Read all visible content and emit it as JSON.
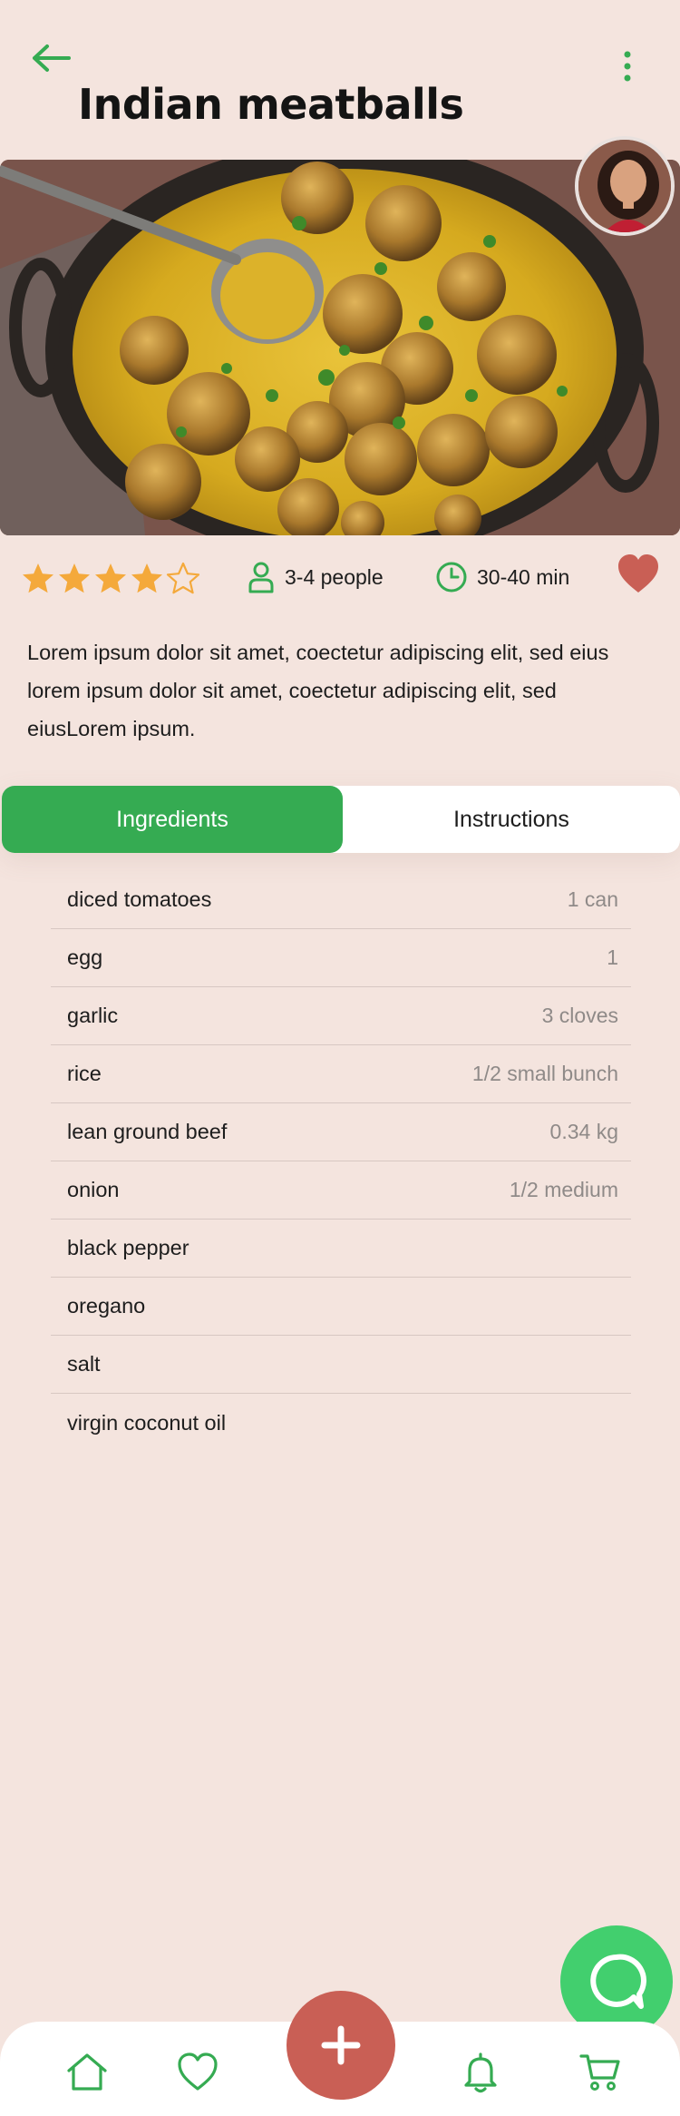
{
  "header": {
    "title": "Indian meatballs",
    "back_icon": "arrow-left-icon",
    "menu_icon": "more-vertical-icon"
  },
  "recipe": {
    "rating": 4,
    "rating_max": 5,
    "servings": "3-4 people",
    "time": "30-40 min",
    "favorite": true,
    "description": "Lorem ipsum dolor sit amet, coectetur adipiscing elit, sed eius lorem ipsum dolor sit amet, coectetur adipiscing elit, sed eiusLorem ipsum."
  },
  "tabs": [
    {
      "label": "Ingredients",
      "active": true
    },
    {
      "label": "Instructions",
      "active": false
    }
  ],
  "ingredients": [
    {
      "name": "diced tomatoes",
      "qty": "1 can"
    },
    {
      "name": "egg",
      "qty": "1"
    },
    {
      "name": "garlic",
      "qty": "3 cloves"
    },
    {
      "name": "rice",
      "qty": "1/2 small bunch"
    },
    {
      "name": "lean ground beef",
      "qty": "0.34 kg"
    },
    {
      "name": "onion",
      "qty": "1/2 medium"
    },
    {
      "name": "black pepper",
      "qty": ""
    },
    {
      "name": "oregano",
      "qty": ""
    },
    {
      "name": "salt",
      "qty": ""
    },
    {
      "name": "virgin coconut oil",
      "qty": ""
    }
  ],
  "nav": {
    "items": [
      "home-icon",
      "heart-icon",
      "plus-icon",
      "bell-icon",
      "cart-icon"
    ]
  },
  "colors": {
    "accent": "#35ab52",
    "star": "#f4a93b",
    "favorite": "#c95f55",
    "background": "#f4e4de"
  }
}
